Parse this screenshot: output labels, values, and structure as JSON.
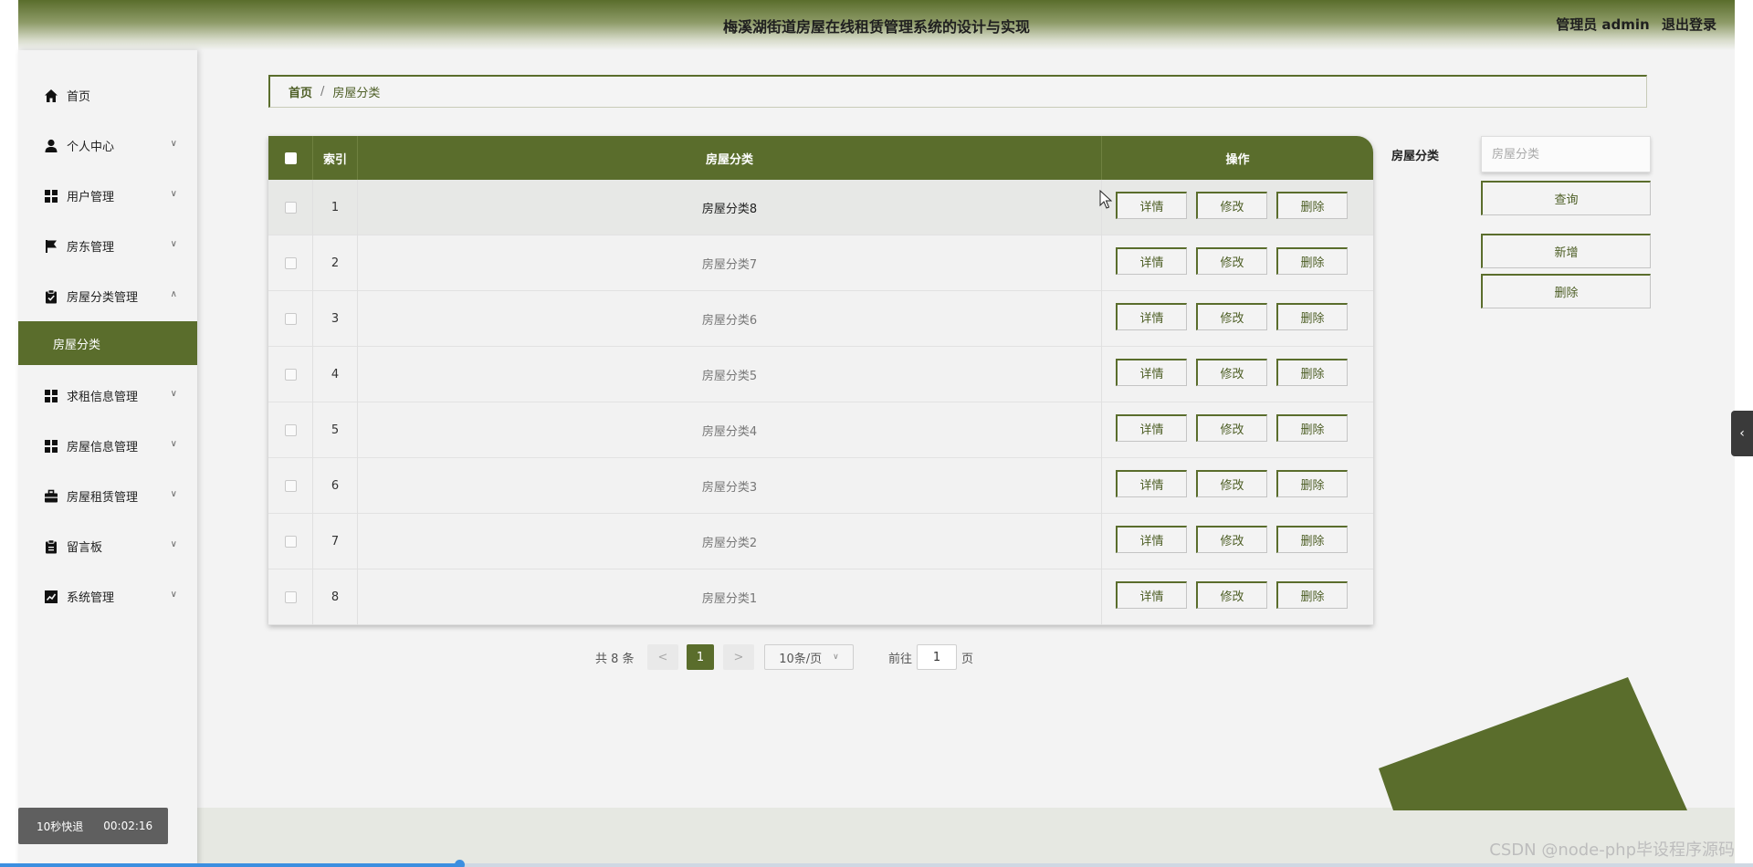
{
  "header": {
    "title": "梅溪湖街道房屋在线租赁管理系统的设计与实现",
    "user_label": "管理员 admin",
    "logout_label": "退出登录"
  },
  "sidebar": {
    "items": [
      {
        "label": "首页",
        "icon": "home-icon"
      },
      {
        "label": "个人中心",
        "icon": "user-icon"
      },
      {
        "label": "用户管理",
        "icon": "grid-icon"
      },
      {
        "label": "房东管理",
        "icon": "flag-icon"
      },
      {
        "label": "房屋分类管理",
        "icon": "clipboard-icon"
      },
      {
        "label": "求租信息管理",
        "icon": "grid-icon"
      },
      {
        "label": "房屋信息管理",
        "icon": "grid-icon"
      },
      {
        "label": "房屋租赁管理",
        "icon": "briefcase-icon"
      },
      {
        "label": "留言板",
        "icon": "clipboard-icon"
      },
      {
        "label": "系统管理",
        "icon": "chart-icon"
      }
    ],
    "active_sub_item": "房屋分类"
  },
  "breadcrumb": {
    "home": "首页",
    "separator": "/",
    "current": "房屋分类"
  },
  "table": {
    "headers": {
      "index": "索引",
      "category": "房屋分类",
      "actions": "操作"
    },
    "rows": [
      {
        "index": "1",
        "name": "房屋分类8"
      },
      {
        "index": "2",
        "name": "房屋分类7"
      },
      {
        "index": "3",
        "name": "房屋分类6"
      },
      {
        "index": "4",
        "name": "房屋分类5"
      },
      {
        "index": "5",
        "name": "房屋分类4"
      },
      {
        "index": "6",
        "name": "房屋分类3"
      },
      {
        "index": "7",
        "name": "房屋分类2"
      },
      {
        "index": "8",
        "name": "房屋分类1"
      }
    ],
    "action_labels": {
      "detail": "详情",
      "edit": "修改",
      "delete": "删除"
    }
  },
  "pagination": {
    "total": "共 8 条",
    "prev": "<",
    "current_page": "1",
    "next": ">",
    "page_size": "10条/页",
    "goto_prefix": "前往",
    "goto_value": "1",
    "goto_suffix": "页"
  },
  "search": {
    "label": "房屋分类",
    "placeholder": "房屋分类",
    "query_button": "查询",
    "add_button": "新增",
    "delete_button": "删除"
  },
  "video": {
    "rewind_label": "10秒快退",
    "time": "00:02:16",
    "progress": 0.262
  },
  "watermark": "CSDN @node-php毕设程序源码",
  "colors": {
    "accent": "#5a6d2c",
    "background": "#f3f3f3"
  }
}
